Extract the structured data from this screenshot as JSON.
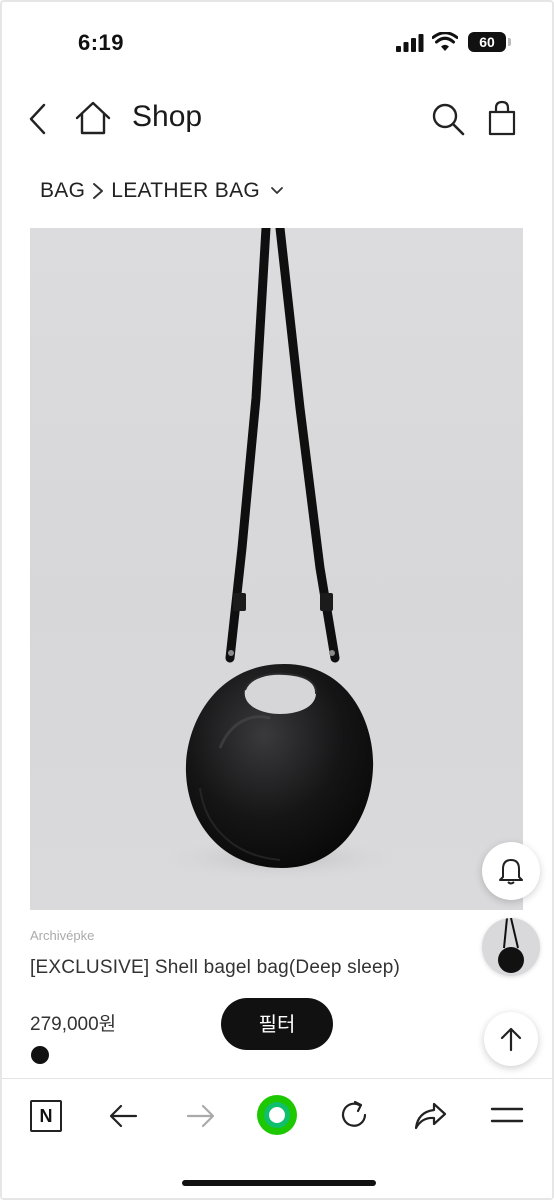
{
  "status": {
    "time": "6:19",
    "battery": "60"
  },
  "header": {
    "title": "Shop"
  },
  "breadcrumb": {
    "level1": "BAG",
    "level2": "LEATHER BAG"
  },
  "product": {
    "brand": "Archivépke",
    "name": "[EXCLUSIVE] Shell bagel bag(Deep sleep)",
    "price": "279,000원",
    "swatch_color": "#111111"
  },
  "filter_button": {
    "label": "필터"
  },
  "bottom_bar": {
    "naver_label": "N"
  },
  "colors": {
    "accent_green": "#1ec800",
    "photo_bg": "#d9d9db"
  }
}
